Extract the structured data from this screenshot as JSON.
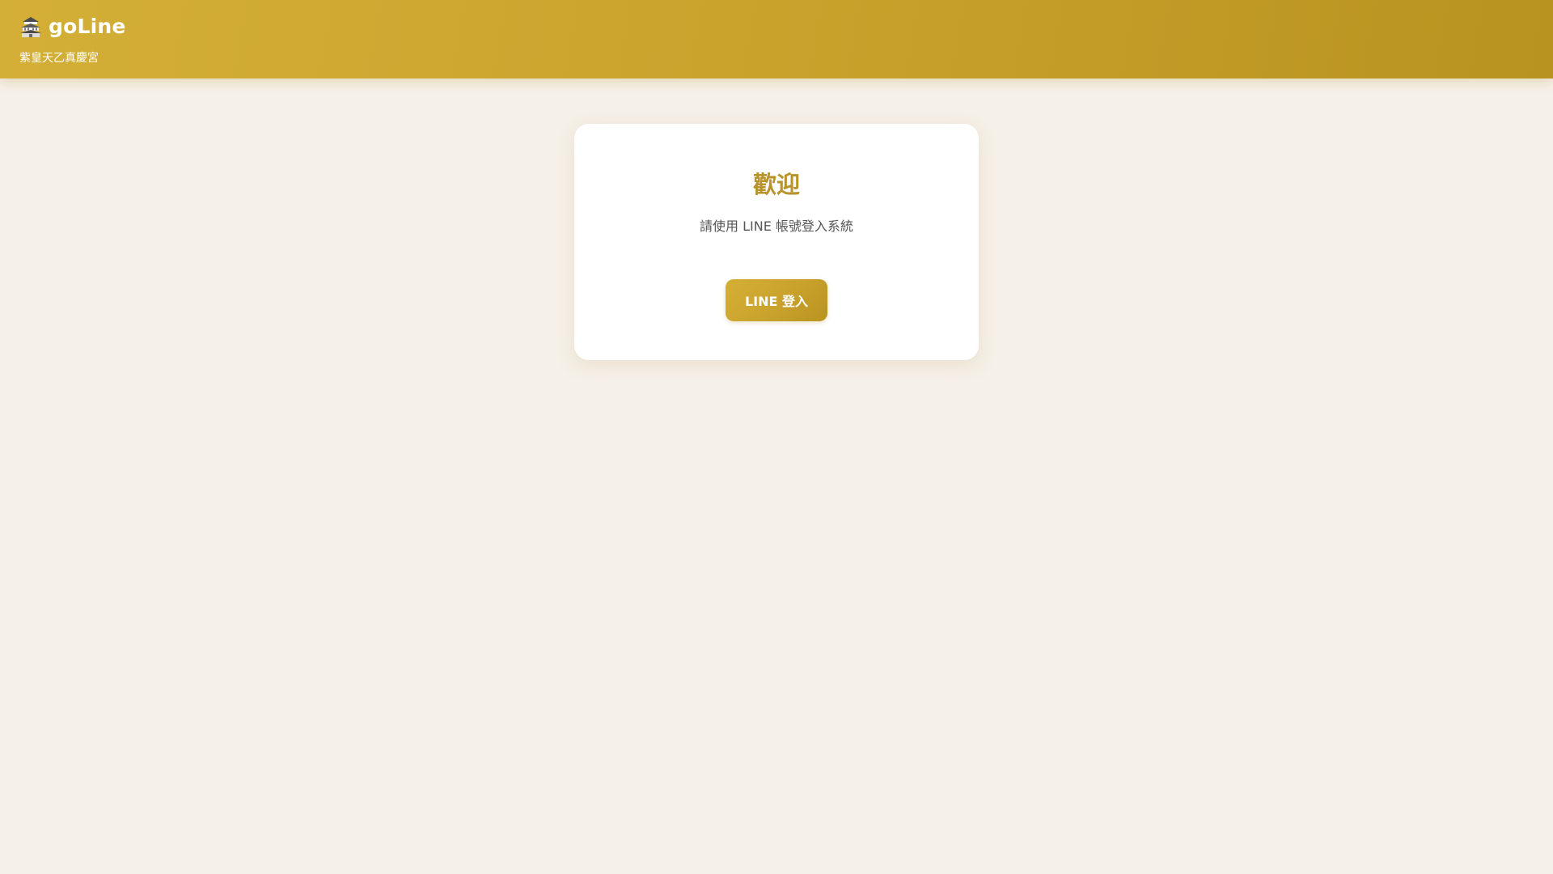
{
  "header": {
    "icon": "temple-icon",
    "title": "goLine",
    "subtitle": "紫皇天乙真慶宮"
  },
  "login_card": {
    "title": "歡迎",
    "description": "請使用 LINE 帳號登入系統",
    "button_label": "LINE 登入"
  },
  "colors": {
    "header_gradient_start": "#d4af37",
    "header_gradient_end": "#b8931f",
    "accent": "#b8922a",
    "page_background": "#f5f0e8",
    "card_background": "#ffffff"
  }
}
